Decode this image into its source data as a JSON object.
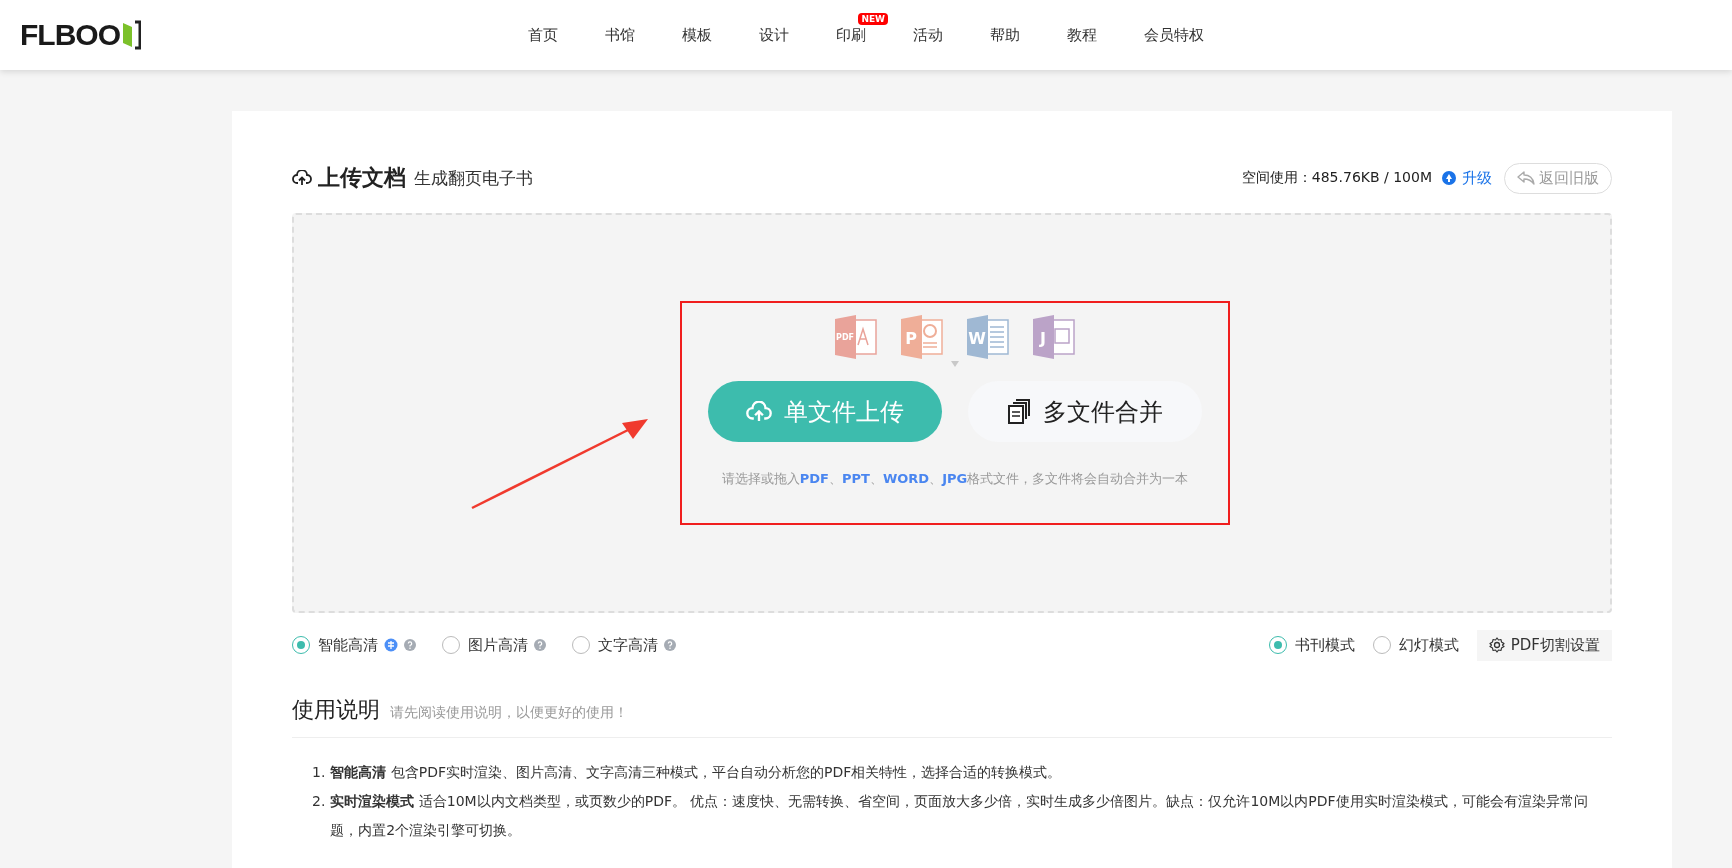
{
  "header": {
    "logo": "FLBOO",
    "nav": [
      {
        "label": "首页"
      },
      {
        "label": "书馆"
      },
      {
        "label": "模板"
      },
      {
        "label": "设计"
      },
      {
        "label": "印刷",
        "badge": "NEW"
      },
      {
        "label": "活动"
      },
      {
        "label": "帮助"
      },
      {
        "label": "教程"
      },
      {
        "label": "会员特权"
      }
    ]
  },
  "upload": {
    "title": "上传文档",
    "subtitle": "生成翻页电子书",
    "space_label": "空间使用：485.76KB / 100M",
    "upgrade": "升级",
    "old_version": "返回旧版",
    "file_types": [
      {
        "kind": "pdf",
        "label": "PDF",
        "color": "#e9a39a"
      },
      {
        "kind": "ppt",
        "label": "P",
        "color": "#efae98"
      },
      {
        "kind": "word",
        "label": "W",
        "color": "#9fb8d3"
      },
      {
        "kind": "jpg",
        "label": "J",
        "color": "#bba3c8"
      }
    ],
    "single_button": "单文件上传",
    "multi_button": "多文件合并",
    "hint": "请选择或拖入**PDF**、**PPT**、**WORD**、**JPG**格式文件，多文件将会自动合并为一本"
  },
  "quality_options": [
    {
      "label": "智能高清",
      "selected": true,
      "recommended": true
    },
    {
      "label": "图片高清",
      "selected": false,
      "recommended": false
    },
    {
      "label": "文字高清",
      "selected": false,
      "recommended": false
    }
  ],
  "mode_options": [
    {
      "label": "书刊模式",
      "selected": true
    },
    {
      "label": "幻灯模式",
      "selected": false
    }
  ],
  "pdf_settings_button": "PDF切割设置",
  "instructions": {
    "title": "使用说明",
    "subtitle": "请先阅读使用说明，以便更好的使用！",
    "items": [
      {
        "number": "1.",
        "text": "**智能高清** 包含PDF实时渲染、图片高清、文字高清三种模式，平台自动分析您的PDF相关特性，选择合适的转换模式。"
      },
      {
        "number": "2.",
        "text": "**实时渲染模式** 适合10M以内文档类型，或页数少的PDF。 优点：速度快、无需转换、省空间，页面放大多少倍，实时生成多少倍图片。缺点：仅允许10M以内PDF使用实时渲染模式，可能会有渲染异常问题，内置2个渲染引擎可切换。"
      }
    ]
  }
}
